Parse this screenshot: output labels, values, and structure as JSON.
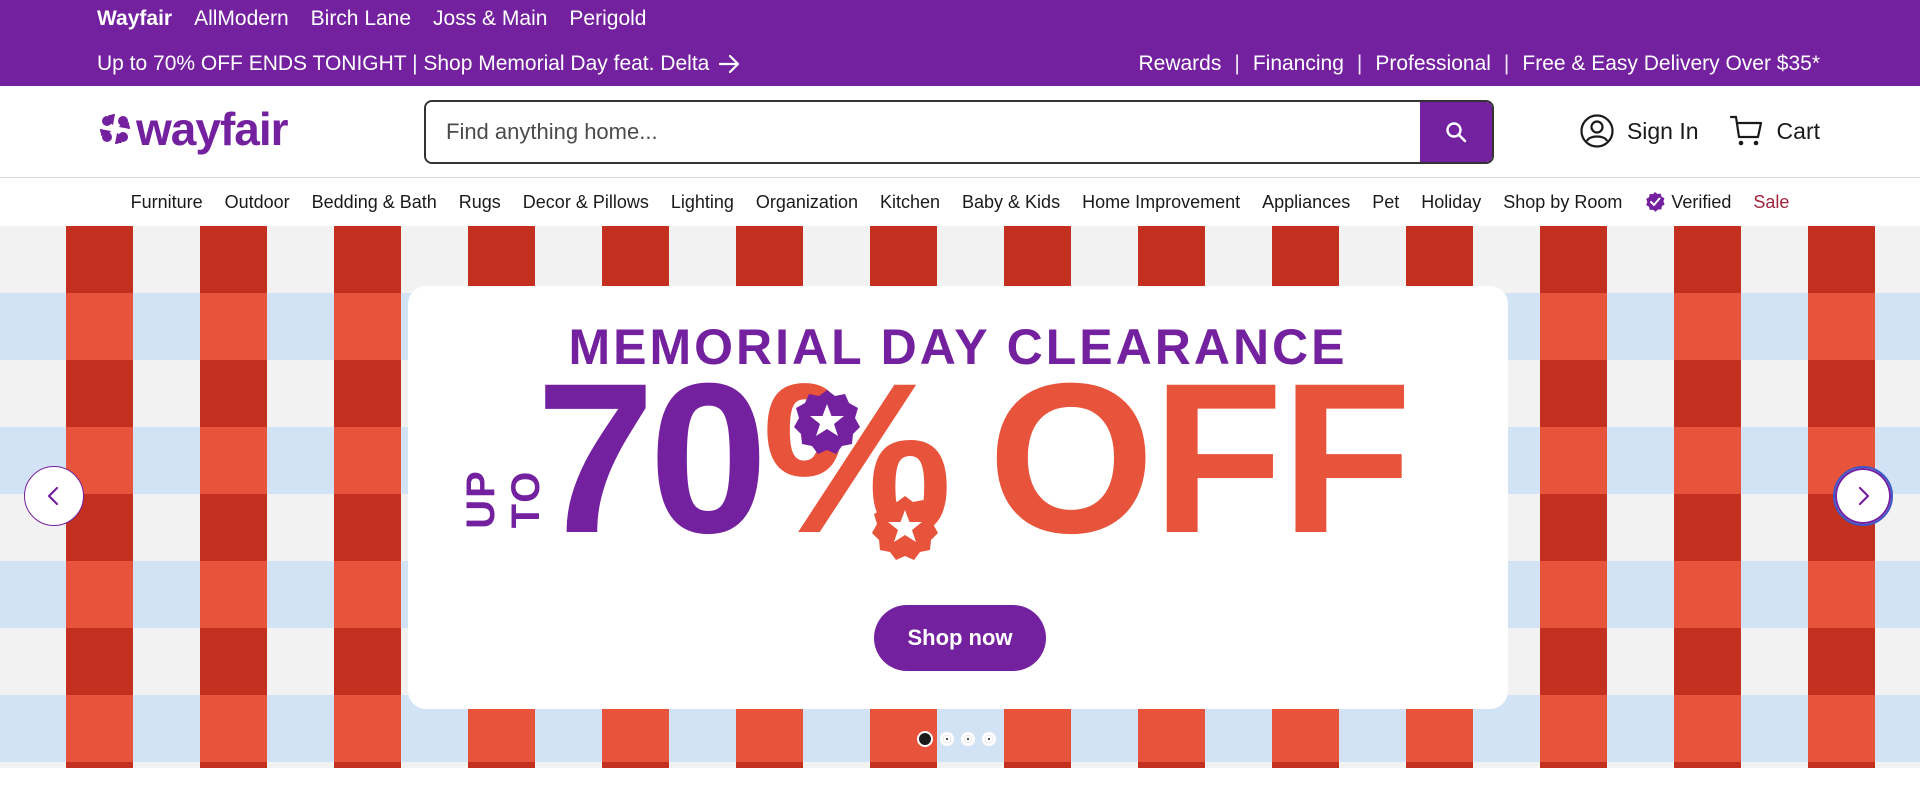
{
  "topbar": {
    "brands": [
      "Wayfair",
      "AllModern",
      "Birch Lane",
      "Joss & Main",
      "Perigold"
    ],
    "promo_text": "Up to 70% OFF ENDS TONIGHT | Shop Memorial Day feat. Delta",
    "links": [
      "Rewards",
      "Financing",
      "Professional",
      "Free & Easy Delivery Over $35*"
    ],
    "separator": "|"
  },
  "header": {
    "logo_text": "wayfair",
    "search_placeholder": "Find anything home...",
    "sign_in": "Sign In",
    "cart": "Cart"
  },
  "nav": {
    "categories": [
      "Furniture",
      "Outdoor",
      "Bedding & Bath",
      "Rugs",
      "Decor & Pillows",
      "Lighting",
      "Organization",
      "Kitchen",
      "Baby & Kids",
      "Home Improvement",
      "Appliances",
      "Pet",
      "Holiday",
      "Shop by Room",
      "Verified",
      "Sale"
    ]
  },
  "hero": {
    "title": "MEMORIAL DAY CLEARANCE",
    "up_to": "UP TO",
    "percent_number": "70",
    "percent_sign": "%",
    "off": "OFF",
    "cta": "Shop now",
    "active_slide": 1,
    "slide_count": 4
  },
  "colors": {
    "brand_purple": "#7421a0",
    "accent_red": "#e8533b",
    "sale_red": "#a3243b"
  },
  "icons": {
    "search": "search-icon",
    "account": "account-icon",
    "cart": "cart-icon",
    "verified": "verified-check-icon",
    "prev": "chevron-left-icon",
    "next": "chevron-right-icon"
  }
}
